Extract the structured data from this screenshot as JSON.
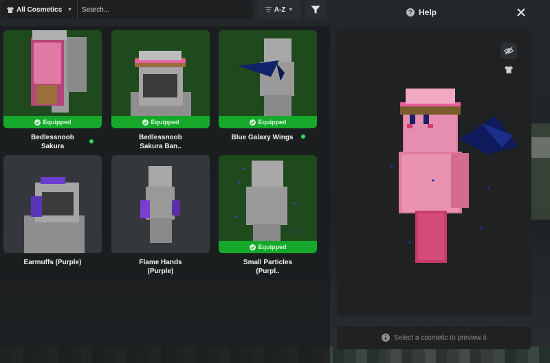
{
  "toolbar": {
    "filter_label": "All Cosmetics",
    "search_placeholder": "Search...",
    "sort_label": "A-Z",
    "filter_button_icon": "funnel-icon",
    "help_label": "Help",
    "close_icon": "close-icon"
  },
  "cosmetics": [
    {
      "name_line1": "Bedlessnoob",
      "name_line2": "Sakura",
      "equipped": true,
      "equipped_label": "Equipped",
      "new_dot": true
    },
    {
      "name_line1": "Bedlessnoob",
      "name_line2": "Sakura Ban..",
      "equipped": true,
      "equipped_label": "Equipped",
      "new_dot": false
    },
    {
      "name_line1": "Blue Galaxy Wings",
      "name_line2": "",
      "equipped": true,
      "equipped_label": "Equipped",
      "new_dot": true
    },
    {
      "name_line1": "Earmuffs (Purple)",
      "name_line2": "",
      "equipped": false,
      "equipped_label": "",
      "new_dot": false
    },
    {
      "name_line1": "Flame Hands",
      "name_line2": "(Purple)",
      "equipped": false,
      "equipped_label": "",
      "new_dot": false
    },
    {
      "name_line1": "Small Particles",
      "name_line2": "(Purpl..",
      "equipped": true,
      "equipped_label": "Equipped",
      "new_dot": false
    }
  ],
  "preview": {
    "hint": "Select a cosmetic to preview it",
    "hide_icon": "eye-off-icon",
    "shirt_icon": "shirt-icon"
  },
  "colors": {
    "equipped_green": "#16a82a",
    "equipped_card": "#1e4a1e",
    "new_dot": "#2ee05a"
  }
}
